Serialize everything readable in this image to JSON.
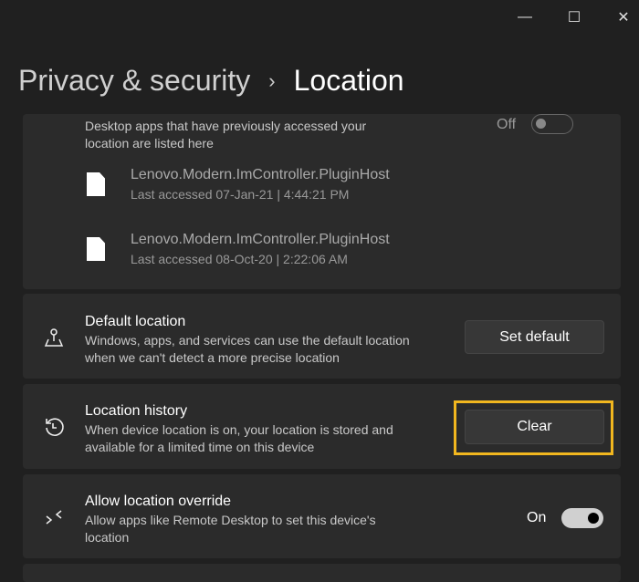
{
  "window": {
    "minimize": "—",
    "maximize": "☐",
    "close": "✕"
  },
  "breadcrumb": {
    "parent": "Privacy & security",
    "separator": "›",
    "current": "Location"
  },
  "desktop_apps": {
    "description": "Desktop apps that have previously accessed your location are listed here",
    "toggle_label": "Off",
    "toggle_on": false,
    "apps": [
      {
        "name": "Lenovo.Modern.ImController.PluginHost",
        "last_accessed": "Last accessed 07-Jan-21  |  4:44:21 PM"
      },
      {
        "name": "Lenovo.Modern.ImController.PluginHost",
        "last_accessed": "Last accessed 08-Oct-20  |  2:22:06 AM"
      }
    ]
  },
  "default_location": {
    "title": "Default location",
    "description": "Windows, apps, and services can use the default location when we can't detect a more precise location",
    "button": "Set default"
  },
  "location_history": {
    "title": "Location history",
    "description": "When device location is on, your location is stored and available for a limited time on this device",
    "button": "Clear",
    "highlight_color": "#f2b71f"
  },
  "location_override": {
    "title": "Allow location override",
    "description": "Allow apps like Remote Desktop to set this device's location",
    "toggle_label": "On",
    "toggle_on": true
  }
}
